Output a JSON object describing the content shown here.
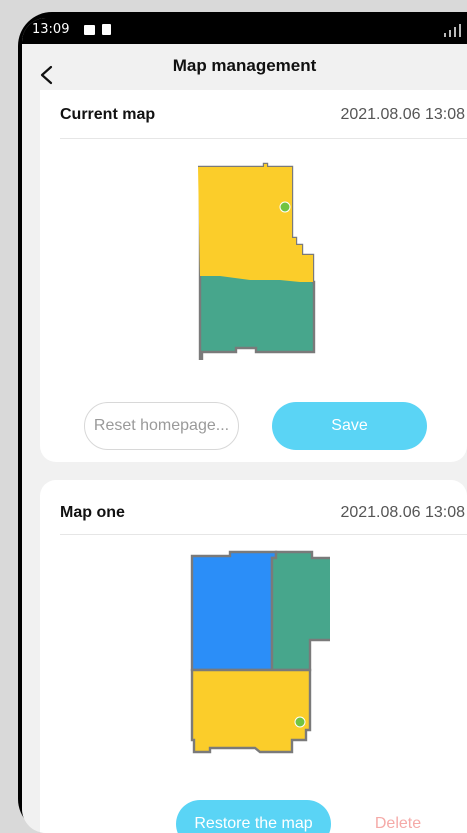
{
  "status": {
    "time": "13:09"
  },
  "header": {
    "title": "Map management"
  },
  "current_map": {
    "name": "Current map",
    "time": "2021.08.06 13:08",
    "reset_label": "Reset homepage...",
    "save_label": "Save"
  },
  "map_one": {
    "name": "Map one",
    "time": "2021.08.06 13:08",
    "restore_label": "Restore the map",
    "delete_label": "Delete"
  },
  "colors": {
    "yellow": "#fbcd2a",
    "green": "#47a68c",
    "blue": "#2b8ef8",
    "dock": "#72c441",
    "outline": "#7a7a7a",
    "accent": "#5ad4f5",
    "delete": "#f5aaa8"
  },
  "icons": [
    "back-chevron-icon",
    "gallery-icon",
    "sd-card-icon",
    "wifi-icon",
    "signal-icon",
    "dock-icon"
  ]
}
